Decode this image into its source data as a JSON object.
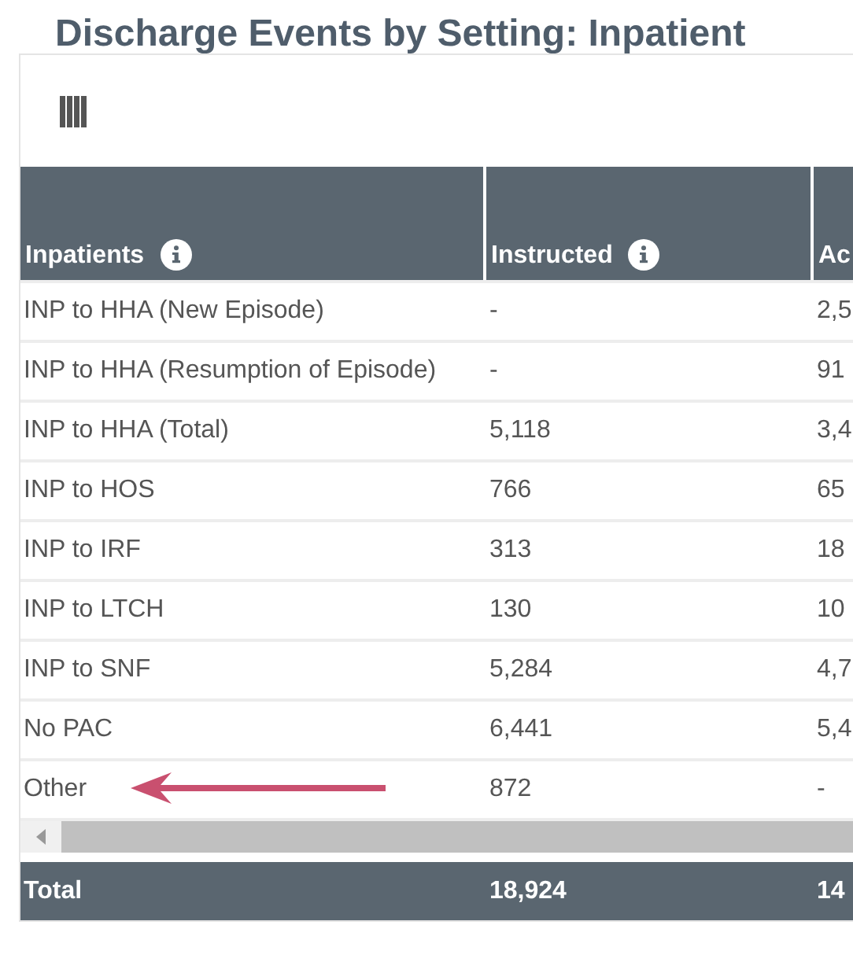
{
  "title": "Discharge Events by Setting: Inpatient",
  "table": {
    "columns": [
      {
        "label": "Inpatients",
        "info": true
      },
      {
        "label": "Instructed",
        "info": true
      },
      {
        "label": "Ac",
        "info": false
      }
    ],
    "rows": [
      {
        "cells": [
          "INP to HHA (New Episode)",
          "-",
          "2,5"
        ],
        "arrow": false
      },
      {
        "cells": [
          "INP to HHA (Resumption of Episode)",
          "-",
          "91"
        ],
        "arrow": false
      },
      {
        "cells": [
          "INP to HHA (Total)",
          "5,118",
          "3,4"
        ],
        "arrow": false
      },
      {
        "cells": [
          "INP to HOS",
          "766",
          "65"
        ],
        "arrow": false
      },
      {
        "cells": [
          "INP to IRF",
          "313",
          "18"
        ],
        "arrow": false
      },
      {
        "cells": [
          "INP to LTCH",
          "130",
          "10"
        ],
        "arrow": false
      },
      {
        "cells": [
          "INP to SNF",
          "5,284",
          "4,7"
        ],
        "arrow": false
      },
      {
        "cells": [
          "No PAC",
          "6,441",
          "5,4"
        ],
        "arrow": false
      },
      {
        "cells": [
          "Other",
          "872",
          "-"
        ],
        "arrow": true
      }
    ],
    "total": [
      "Total",
      "18,924",
      "14"
    ]
  }
}
